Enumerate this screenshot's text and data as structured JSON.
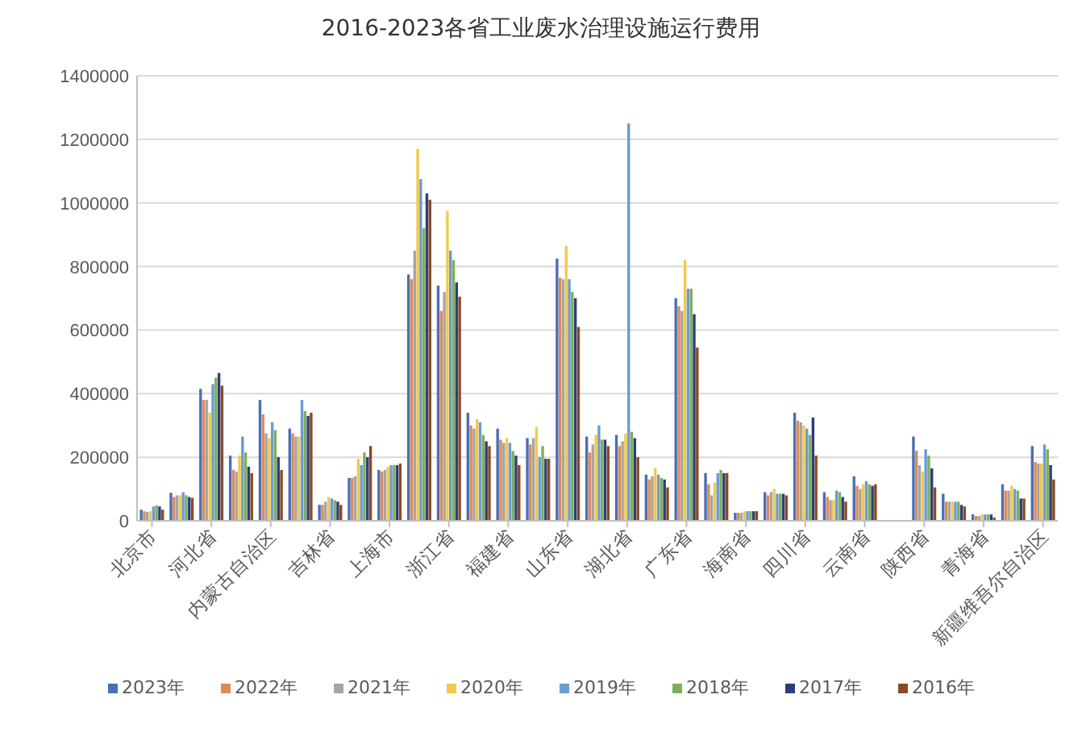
{
  "chart_data": {
    "type": "bar",
    "title": "2016-2023各省工业废水治理设施运行费用",
    "stacked": false,
    "grid": true,
    "legend": "bottom",
    "categories": [
      "北京市",
      null,
      "河北省",
      null,
      "内蒙古自治区",
      null,
      "吉林省",
      null,
      "上海市",
      null,
      "浙江省",
      null,
      "福建省",
      null,
      "山东省",
      null,
      "湖北省",
      null,
      "广东省",
      null,
      "海南省",
      null,
      "四川省",
      null,
      "云南省",
      null,
      "陕西省",
      null,
      "青海省",
      null,
      "新疆维吾尔自治区"
    ],
    "ylim": [
      0,
      1400000
    ],
    "yticks": [
      0,
      200000,
      400000,
      600000,
      800000,
      1000000,
      1200000,
      1400000
    ],
    "series": [
      {
        "name": "2023年",
        "color": "#4a6fb5",
        "values": [
          35000,
          88000,
          415000,
          205000,
          380000,
          290000,
          50000,
          135000,
          160000,
          775000,
          740000,
          340000,
          290000,
          260000,
          825000,
          265000,
          270000,
          145000,
          700000,
          150000,
          25000,
          90000,
          340000,
          90000,
          140000,
          null,
          265000,
          85000,
          20000,
          115000,
          235000
        ]
      },
      {
        "name": "2022年",
        "color": "#dd8a5a",
        "values": [
          30000,
          75000,
          380000,
          160000,
          335000,
          275000,
          50000,
          135000,
          155000,
          760000,
          660000,
          300000,
          255000,
          240000,
          765000,
          215000,
          235000,
          130000,
          675000,
          115000,
          25000,
          80000,
          315000,
          75000,
          110000,
          null,
          220000,
          60000,
          15000,
          95000,
          185000
        ]
      },
      {
        "name": "2021年",
        "color": "#a5a5a5",
        "values": [
          28000,
          80000,
          380000,
          155000,
          275000,
          265000,
          60000,
          140000,
          160000,
          850000,
          720000,
          290000,
          245000,
          260000,
          760000,
          240000,
          250000,
          140000,
          660000,
          80000,
          25000,
          90000,
          310000,
          65000,
          100000,
          null,
          175000,
          60000,
          15000,
          95000,
          180000
        ]
      },
      {
        "name": "2020年",
        "color": "#f2c94c",
        "values": [
          30000,
          80000,
          340000,
          205000,
          260000,
          265000,
          75000,
          195000,
          170000,
          1170000,
          975000,
          320000,
          260000,
          295000,
          865000,
          270000,
          275000,
          165000,
          820000,
          120000,
          30000,
          100000,
          300000,
          65000,
          115000,
          null,
          155000,
          60000,
          20000,
          110000,
          180000
        ]
      },
      {
        "name": "2019年",
        "color": "#6c9bd2",
        "values": [
          45000,
          90000,
          430000,
          265000,
          310000,
          380000,
          70000,
          175000,
          175000,
          1075000,
          850000,
          310000,
          245000,
          200000,
          760000,
          300000,
          1250000,
          145000,
          730000,
          150000,
          30000,
          85000,
          290000,
          95000,
          125000,
          null,
          225000,
          60000,
          20000,
          100000,
          240000
        ]
      },
      {
        "name": "2018年",
        "color": "#7fae5a",
        "values": [
          48000,
          80000,
          450000,
          215000,
          285000,
          345000,
          65000,
          215000,
          175000,
          920000,
          820000,
          270000,
          220000,
          235000,
          720000,
          255000,
          280000,
          135000,
          730000,
          160000,
          30000,
          85000,
          270000,
          90000,
          115000,
          null,
          205000,
          60000,
          20000,
          95000,
          225000
        ]
      },
      {
        "name": "2017年",
        "color": "#2c3e7a",
        "values": [
          45000,
          75000,
          465000,
          170000,
          200000,
          330000,
          60000,
          200000,
          175000,
          1030000,
          750000,
          250000,
          205000,
          195000,
          700000,
          255000,
          260000,
          130000,
          650000,
          150000,
          30000,
          85000,
          325000,
          75000,
          110000,
          null,
          165000,
          50000,
          20000,
          70000,
          175000
        ]
      },
      {
        "name": "2016年",
        "color": "#8b4a24",
        "values": [
          35000,
          72000,
          425000,
          150000,
          160000,
          340000,
          50000,
          235000,
          180000,
          1010000,
          705000,
          235000,
          175000,
          195000,
          610000,
          235000,
          200000,
          105000,
          545000,
          150000,
          30000,
          80000,
          205000,
          60000,
          115000,
          null,
          105000,
          45000,
          10000,
          70000,
          130000
        ]
      }
    ]
  }
}
